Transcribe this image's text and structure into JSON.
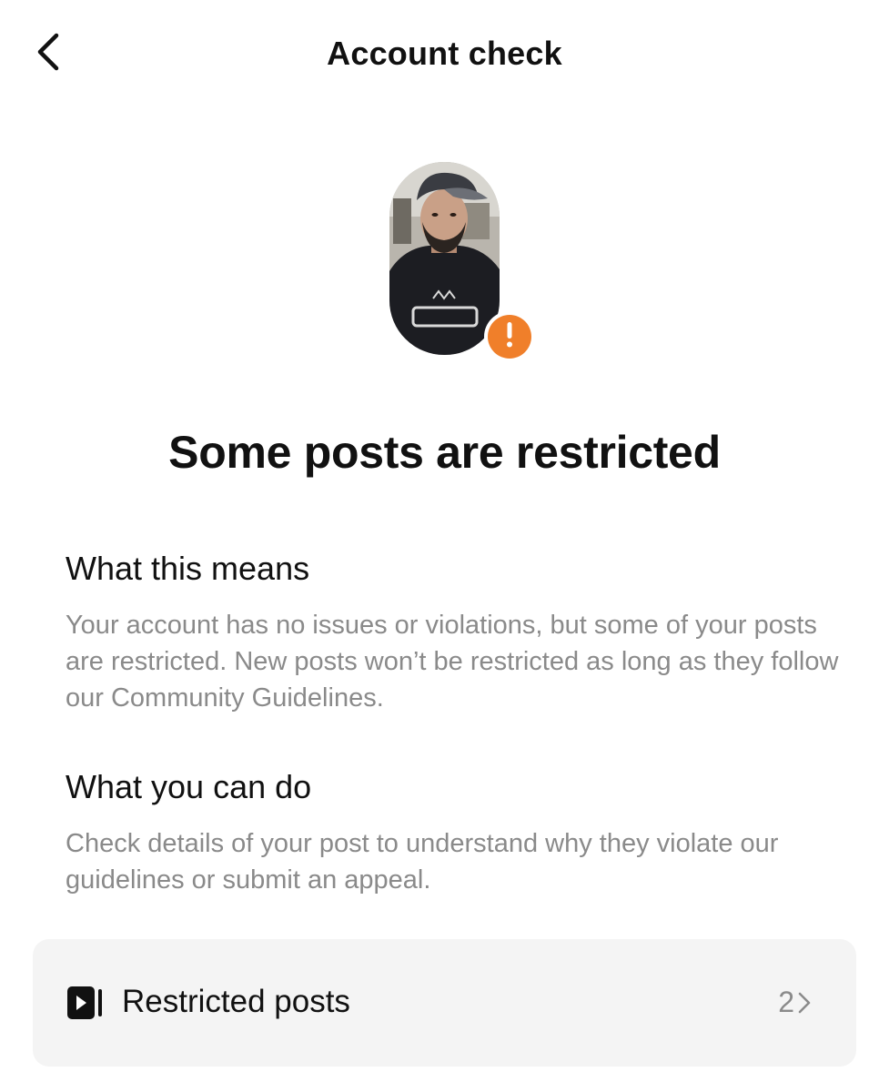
{
  "header": {
    "title": "Account check",
    "back_icon": "chevron-left-icon"
  },
  "status": {
    "headline": "Some posts are restricted",
    "badge_icon": "exclamation-icon",
    "badge_color": "#f07f2a"
  },
  "sections": [
    {
      "title": "What this means",
      "body": "Your account has no issues or violations, but some of your posts are restricted. New posts won’t be restricted as long as they follow our Community Guidelines."
    },
    {
      "title": "What you can do",
      "body": "Check details of your post to understand why they violate our guidelines or submit an appeal."
    }
  ],
  "restricted_posts": {
    "label": "Restricted posts",
    "count": "2",
    "icon": "video-play-icon"
  }
}
